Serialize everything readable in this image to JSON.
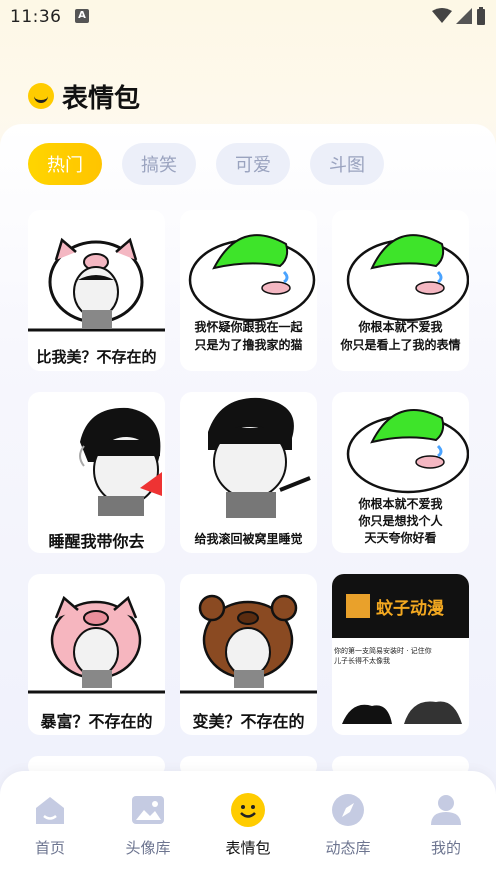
{
  "status": {
    "time": "11:36",
    "notif_icon": "A"
  },
  "header": {
    "title": "表情包",
    "icon": "smile-icon"
  },
  "tabs": [
    {
      "label": "热门",
      "active": true
    },
    {
      "label": "搞笑",
      "active": false
    },
    {
      "label": "可爱",
      "active": false
    },
    {
      "label": "斗图",
      "active": false
    }
  ],
  "cards": [
    {
      "type": "pig-hood",
      "caption": "比我美？不存在的"
    },
    {
      "type": "green-helmet",
      "caption_lines": [
        "我怀疑你跟我在一起",
        "只是为了撸我家的猫"
      ]
    },
    {
      "type": "green-helmet",
      "caption_lines": [
        "你根本就不爱我",
        "你只是看上了我的表情"
      ]
    },
    {
      "type": "bowl-cut-smoke",
      "caption": "睡醒我带你去"
    },
    {
      "type": "bowl-cut-point",
      "caption": "给我滚回被窝里睡觉"
    },
    {
      "type": "green-helmet",
      "caption_lines": [
        "你根本就不爱我",
        "你只是想找个人",
        "天天夸你好看"
      ]
    },
    {
      "type": "pink-pig-hood",
      "caption": "暴富？不存在的"
    },
    {
      "type": "bear-hood",
      "caption": "变美？不存在的"
    },
    {
      "type": "promo",
      "brand": "蚊子动漫",
      "line1": "你的第一支简易安装时 · 记住你",
      "line2": "儿子长得不太像我"
    }
  ],
  "nav": [
    {
      "label": "首页",
      "icon": "home-icon",
      "active": false
    },
    {
      "label": "头像库",
      "icon": "image-icon",
      "active": false
    },
    {
      "label": "表情包",
      "icon": "smile-icon",
      "active": true
    },
    {
      "label": "动态库",
      "icon": "compass-icon",
      "active": false
    },
    {
      "label": "我的",
      "icon": "user-icon",
      "active": false
    }
  ],
  "colors": {
    "accent": "#ffcc00",
    "nav_inactive": "#c5cbe2",
    "tab_bg": "#eceff9",
    "helmet_green": "#3ee42a"
  }
}
